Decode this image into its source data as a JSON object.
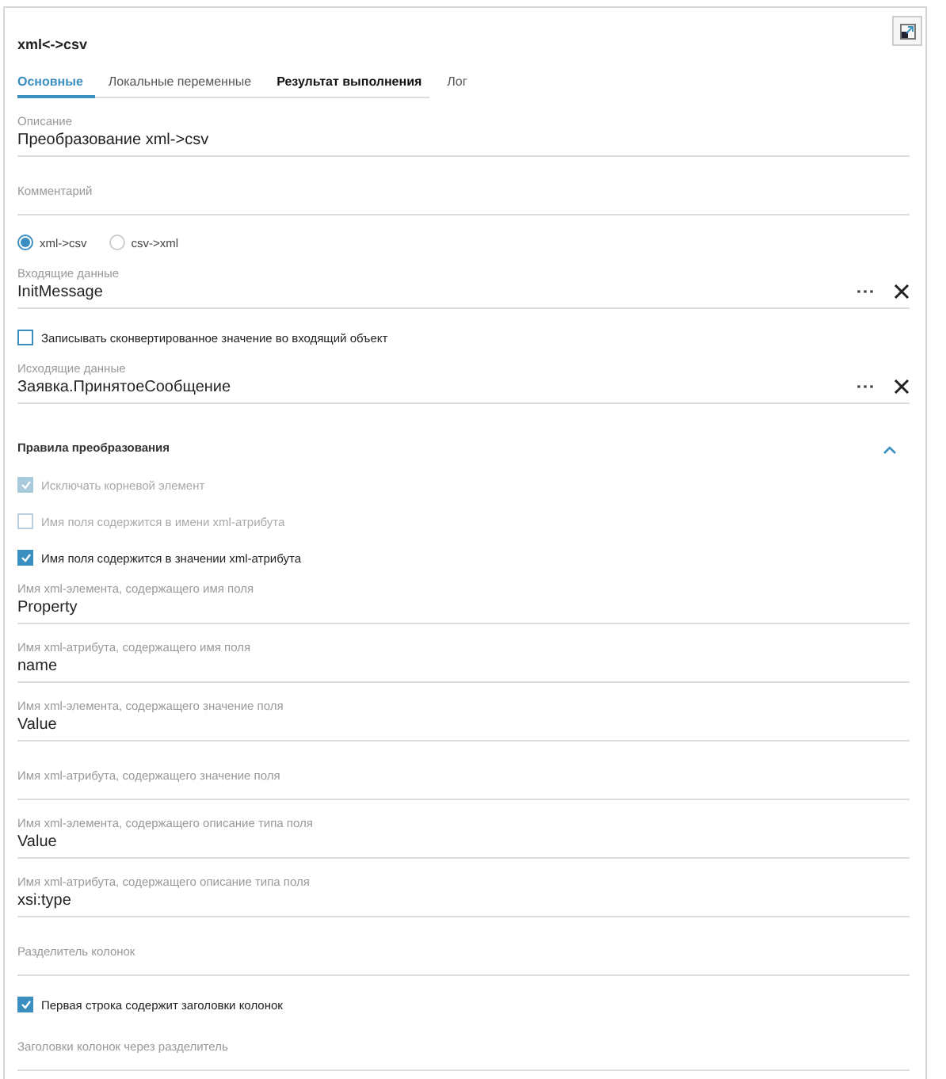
{
  "title": "xml<->csv",
  "tabs": [
    {
      "label": "Основные",
      "selected": true,
      "highlighted": false
    },
    {
      "label": "Локальные переменные",
      "selected": false,
      "highlighted": false
    },
    {
      "label": "Результат выполнения",
      "selected": false,
      "highlighted": true
    },
    {
      "label": "Лог",
      "selected": false,
      "highlighted": false
    }
  ],
  "items": [
    {
      "kind": "field",
      "label": "Описание",
      "value": "Преобразование xml->csv",
      "actions": false
    },
    {
      "kind": "field",
      "placeholder": "Комментарий",
      "actions": false
    },
    {
      "kind": "radios",
      "options": [
        {
          "label": "xml->csv",
          "selected": true
        },
        {
          "label": "csv->xml",
          "selected": false
        }
      ]
    },
    {
      "kind": "field",
      "label": "Входящие данные",
      "value": "InitMessage",
      "actions": true
    },
    {
      "kind": "checkbox",
      "label": "Записывать сконвертированное значение во входящий объект",
      "checked": false,
      "disabled": false
    },
    {
      "kind": "field",
      "label": "Исходящие данные",
      "value": "Заявка.ПринятоеСообщение",
      "actions": true
    },
    {
      "kind": "section",
      "title": "Правила преобразования",
      "expanded": true
    },
    {
      "kind": "checkbox",
      "label": "Исключать корневой элемент",
      "checked": true,
      "disabled": true
    },
    {
      "kind": "checkbox",
      "label": "Имя поля содержится в имени xml-атрибута",
      "checked": false,
      "disabled": true
    },
    {
      "kind": "checkbox",
      "label": "Имя поля содержится в значении xml-атрибута",
      "checked": true,
      "disabled": false
    },
    {
      "kind": "field",
      "label": "Имя xml-элемента, содержащего имя поля",
      "value": "Property",
      "actions": false
    },
    {
      "kind": "field",
      "label": "Имя xml-атрибута, содержащего имя поля",
      "value": "name",
      "actions": false
    },
    {
      "kind": "field",
      "label": "Имя xml-элемента, содержащего значение поля",
      "value": "Value",
      "actions": false
    },
    {
      "kind": "field",
      "placeholder": "Имя xml-атрибута, содержащего значение поля",
      "actions": false
    },
    {
      "kind": "field",
      "label": "Имя xml-элемента, содержащего описание типа поля",
      "value": "Value",
      "actions": false
    },
    {
      "kind": "field",
      "label": "Имя xml-атрибута, содержащего описание типа поля",
      "value": "xsi:type",
      "actions": false
    },
    {
      "kind": "field",
      "placeholder": "Разделитель колонок",
      "actions": false
    },
    {
      "kind": "checkbox",
      "label": "Первая строка содержит заголовки колонок",
      "checked": true,
      "disabled": false
    },
    {
      "kind": "field",
      "placeholder": "Заголовки колонок через разделитель",
      "actions": false
    }
  ]
}
